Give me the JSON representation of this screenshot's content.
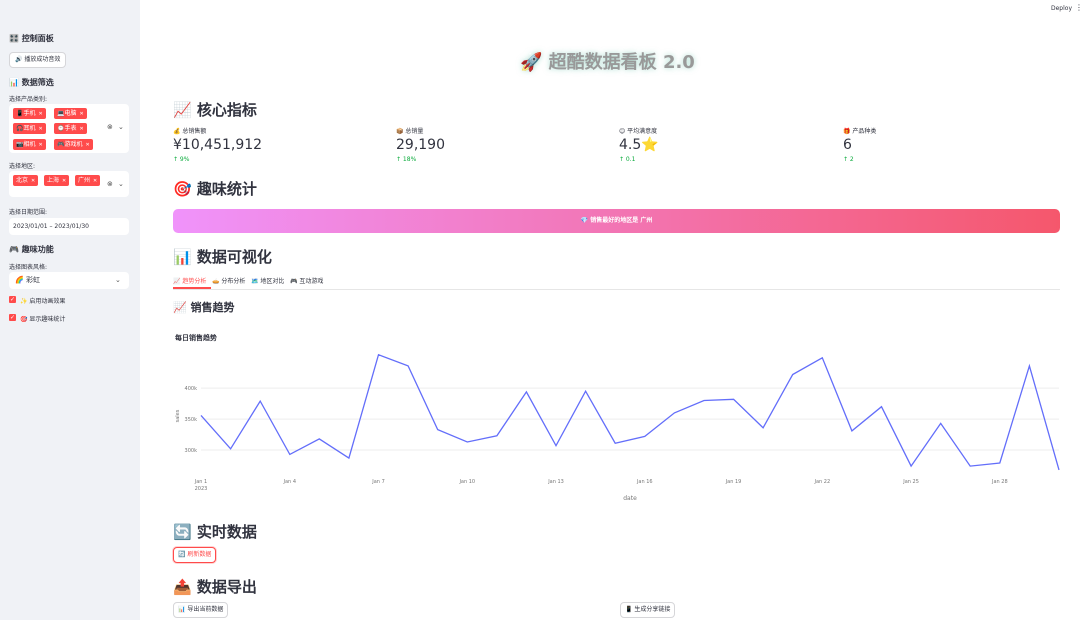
{
  "header": {
    "deploy_label": "Deploy",
    "menu_icon": "more-vertical-icon"
  },
  "sidebar": {
    "title": "🎛️ 控制面板",
    "sound_button": "🔊 播放成功音效",
    "filter_title": "📊 数据筛选",
    "category_label": "选择产品类别:",
    "categories": [
      "📱手机",
      "💻电脑",
      "🎧耳机",
      "⌚手表",
      "📷相机",
      "🎮游戏机"
    ],
    "region_label": "选择地区:",
    "regions": [
      "北京",
      "上海",
      "广州"
    ],
    "date_label": "选择日期范围:",
    "date_value": "2023/01/01 – 2023/01/30",
    "fun_title": "🎮 趣味功能",
    "style_label": "选择图表风格:",
    "style_value": "🌈 彩虹",
    "checkbox_animation": "✨ 启用动画效果",
    "checkbox_stats": "🎯 显示趣味统计"
  },
  "main": {
    "title": "🚀 超酷数据看板 2.0",
    "kpi_title": "📈 核心指标",
    "metrics": [
      {
        "label": "💰 总销售额",
        "value": "¥10,451,912",
        "delta": "↑ 9%"
      },
      {
        "label": "📦 总销量",
        "value": "29,190",
        "delta": "↑ 18%"
      },
      {
        "label": "😊 平均满意度",
        "value": "4.5⭐",
        "delta": "↑ 0.1"
      },
      {
        "label": "🎁 产品种类",
        "value": "6",
        "delta": "↑ 2"
      }
    ],
    "fun_stats_title": "🎯 趣味统计",
    "banner_text": "💎 销售最好的地区是 广州",
    "viz_title": "📊 数据可视化",
    "tabs": [
      "📈 趋势分析",
      "🥧 分布分析",
      "🗺️ 地区对比",
      "🎮 互动游戏"
    ],
    "trend_title": "📈 销售趋势",
    "realtime_title": "🔄 实时数据",
    "refresh_button": "🔄 刷新数据",
    "export_title": "📤 数据导出",
    "export_button": "📊 导出当前数据",
    "share_button": "📱 生成分享链接"
  },
  "colors": {
    "accent": "#ff4b4b",
    "line": "#636efa",
    "positive": "#09ab3b",
    "banner_start": "#f093fb",
    "banner_end": "#f5576c"
  },
  "chart_data": {
    "type": "line",
    "title": "每日销售趋势",
    "xlabel": "date",
    "ylabel": "sales",
    "x": [
      "2023-01-01",
      "2023-01-02",
      "2023-01-03",
      "2023-01-04",
      "2023-01-05",
      "2023-01-06",
      "2023-01-07",
      "2023-01-08",
      "2023-01-09",
      "2023-01-10",
      "2023-01-11",
      "2023-01-12",
      "2023-01-13",
      "2023-01-14",
      "2023-01-15",
      "2023-01-16",
      "2023-01-17",
      "2023-01-18",
      "2023-01-19",
      "2023-01-20",
      "2023-01-21",
      "2023-01-22",
      "2023-01-23",
      "2023-01-24",
      "2023-01-25",
      "2023-01-26",
      "2023-01-27",
      "2023-01-28",
      "2023-01-29",
      "2023-01-30"
    ],
    "values": [
      356000,
      302000,
      379000,
      293000,
      318000,
      287000,
      454000,
      436000,
      333000,
      313000,
      323000,
      394000,
      307000,
      395000,
      311000,
      322000,
      360000,
      380000,
      382000,
      336000,
      422000,
      449000,
      331000,
      370000,
      274000,
      343000,
      274000,
      279000,
      436000,
      268000
    ],
    "xticks": [
      {
        "date": "2023-01-01",
        "label": "Jan 1",
        "sublabel": "2023"
      },
      {
        "date": "2023-01-04",
        "label": "Jan 4"
      },
      {
        "date": "2023-01-07",
        "label": "Jan 7"
      },
      {
        "date": "2023-01-10",
        "label": "Jan 10"
      },
      {
        "date": "2023-01-13",
        "label": "Jan 13"
      },
      {
        "date": "2023-01-16",
        "label": "Jan 16"
      },
      {
        "date": "2023-01-19",
        "label": "Jan 19"
      },
      {
        "date": "2023-01-22",
        "label": "Jan 22"
      },
      {
        "date": "2023-01-25",
        "label": "Jan 25"
      },
      {
        "date": "2023-01-28",
        "label": "Jan 28"
      }
    ],
    "yticks": [
      {
        "value": 300000,
        "label": "300k"
      },
      {
        "value": 350000,
        "label": "350k"
      },
      {
        "value": 400000,
        "label": "400k"
      }
    ],
    "ylim": [
      250000,
      460000
    ],
    "grid": true
  }
}
